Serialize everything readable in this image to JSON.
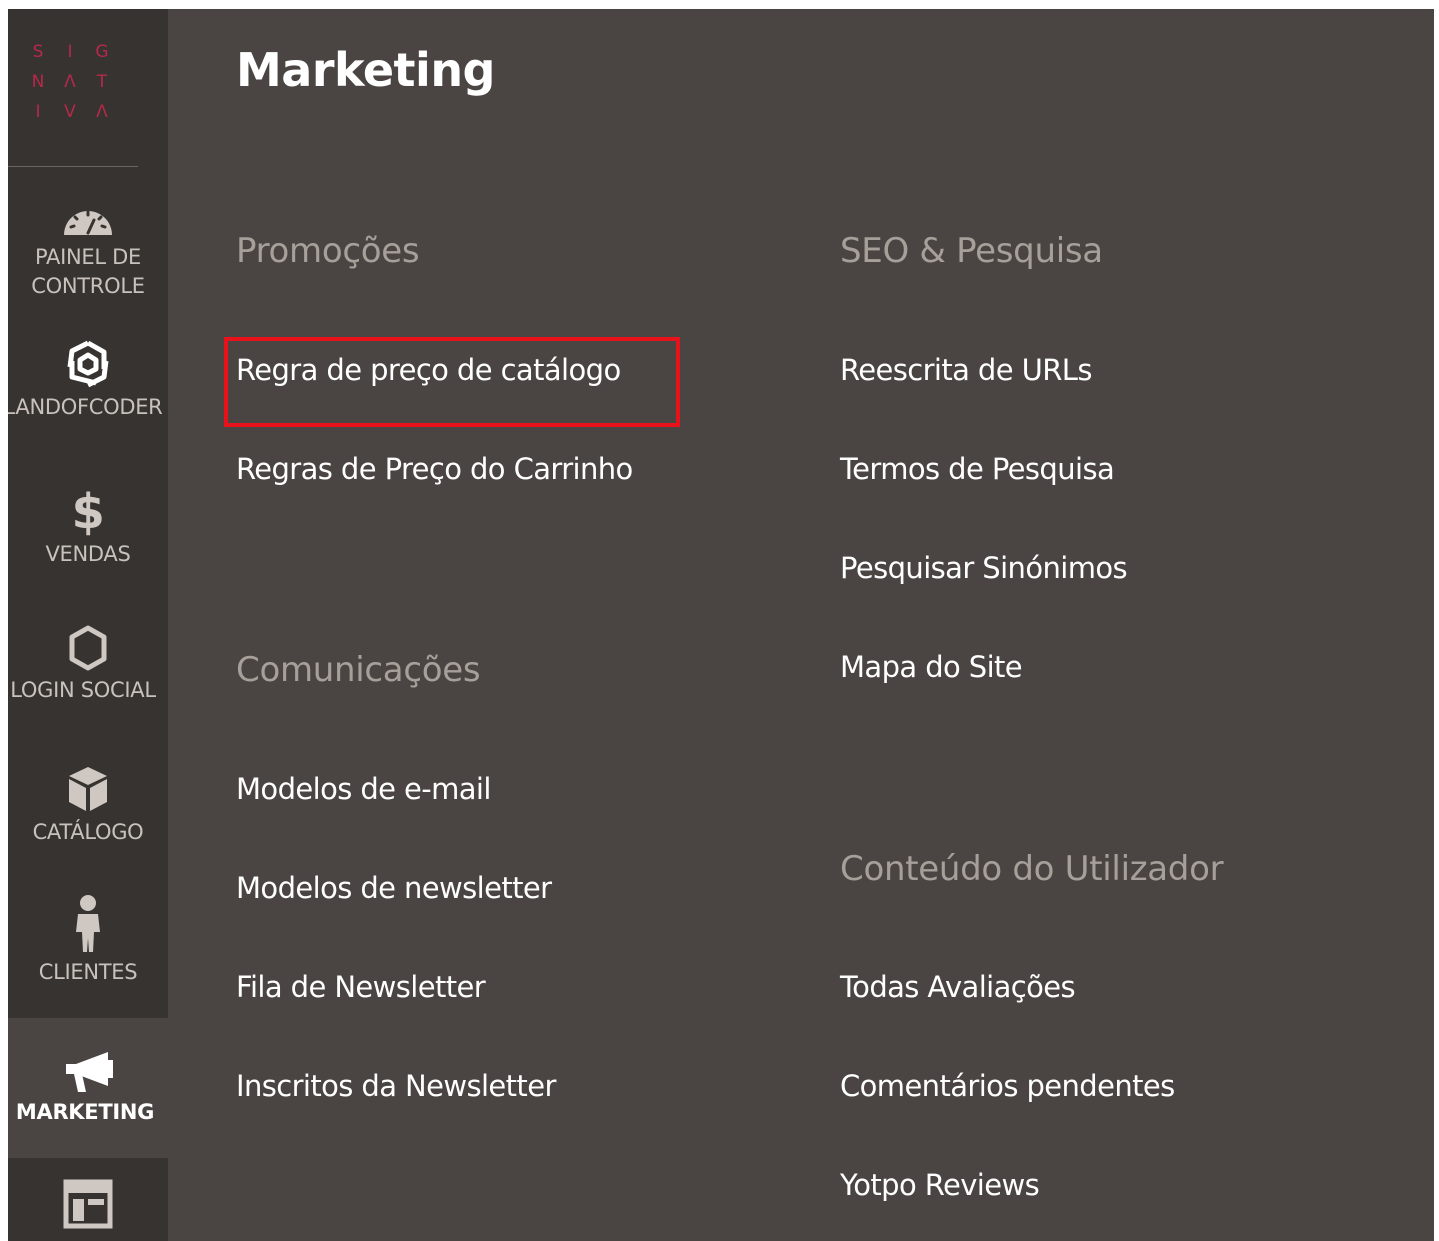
{
  "logo": {
    "letters": [
      "S",
      "I",
      "G",
      "N",
      "Λ",
      "T",
      "I",
      "V",
      "Λ"
    ],
    "color": "#b5294a"
  },
  "sidebar": {
    "items": [
      {
        "label_line1": "PAINEL DE",
        "label_line2": "CONTROLE",
        "icon": "dashboard-icon"
      },
      {
        "label_line1": "LANDOFCODER",
        "label_line2": "",
        "icon": "landofcoder-icon"
      },
      {
        "label_line1": "VENDAS",
        "label_line2": "",
        "icon": "dollar-icon"
      },
      {
        "label_line1": "LOGIN SOCIAL",
        "label_line2": "",
        "icon": "hexagon-icon"
      },
      {
        "label_line1": "CATÁLOGO",
        "label_line2": "",
        "icon": "box-icon"
      },
      {
        "label_line1": "CLIENTES",
        "label_line2": "",
        "icon": "person-icon"
      },
      {
        "label_line1": "MARKETING",
        "label_line2": "",
        "icon": "megaphone-icon",
        "active": true
      },
      {
        "label_line1": "",
        "label_line2": "",
        "icon": "layout-icon"
      }
    ]
  },
  "main": {
    "title": "Marketing",
    "sections": {
      "promocoes": {
        "title": "Promoções",
        "links": [
          "Regra de preço de catálogo",
          "Regras de Preço do Carrinho"
        ]
      },
      "comunicacoes": {
        "title": "Comunicações",
        "links": [
          "Modelos de e-mail",
          "Modelos de newsletter",
          "Fila de Newsletter",
          "Inscritos da Newsletter"
        ]
      },
      "seo": {
        "title": "SEO & Pesquisa",
        "links": [
          "Reescrita de URLs",
          "Termos de Pesquisa",
          "Pesquisar Sinónimos",
          "Mapa do Site"
        ]
      },
      "conteudo": {
        "title": "Conteúdo do Utilizador",
        "links": [
          "Todas Avaliações",
          "Comentários pendentes",
          "Yotpo Reviews"
        ]
      }
    }
  },
  "colors": {
    "background": "#4a4542",
    "sidebar": "#373330",
    "section_title": "#a79f99",
    "highlight": "#e8131a"
  }
}
